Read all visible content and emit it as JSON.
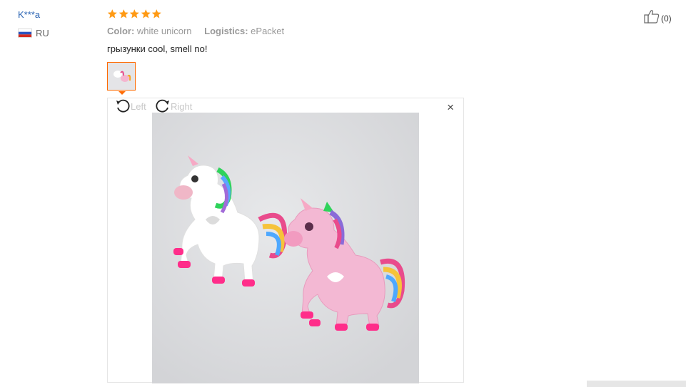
{
  "reviewer": {
    "name": "K***a",
    "country": "RU",
    "flag_colors": [
      "#ffffff",
      "#2a52be",
      "#d52b1e"
    ]
  },
  "rating": {
    "stars": 5,
    "max": 5,
    "star_color": "#ff9a14"
  },
  "attributes": [
    {
      "key": "Color:",
      "value": "white unicorn"
    },
    {
      "key": "Logistics:",
      "value": "ePacket"
    }
  ],
  "feedback": {
    "text": "грызунки cool, smell no!"
  },
  "helpful": {
    "count": "(0)"
  },
  "viewer": {
    "rotate_left_label": "Left",
    "rotate_right_label": "Right",
    "close_glyph": "×"
  },
  "colors": {
    "accent": "#ff6a00",
    "link": "#2b64b3"
  }
}
